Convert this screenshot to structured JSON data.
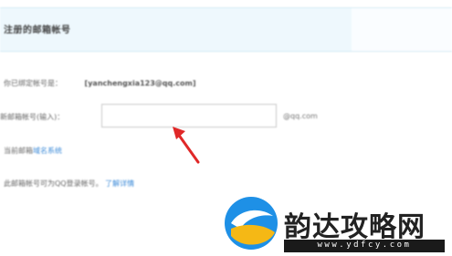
{
  "header": {
    "title": "注册的邮箱帐号"
  },
  "bound": {
    "label": "你已绑定帐号是：",
    "email": "[yanchengxia123@qq.com]"
  },
  "new_email": {
    "label": "新邮箱帐号(输入)：",
    "value": "",
    "placeholder": "",
    "domain": "@qq.com"
  },
  "links": {
    "row1_prefix": "当前邮箱",
    "row1_link": "域名系统",
    "row2_prefix": "此邮箱帐号可为QQ登录帐号。",
    "row2_link": "了解详情"
  },
  "watermark": {
    "name": "韵达攻略网",
    "url": "www.ydfcy.com"
  },
  "colors": {
    "header_bg": "#eef8fd",
    "link": "#3b8ad8",
    "arrow": "#e02828",
    "logo_blue": "#1e90e6",
    "logo_yellow": "#f5b815"
  }
}
